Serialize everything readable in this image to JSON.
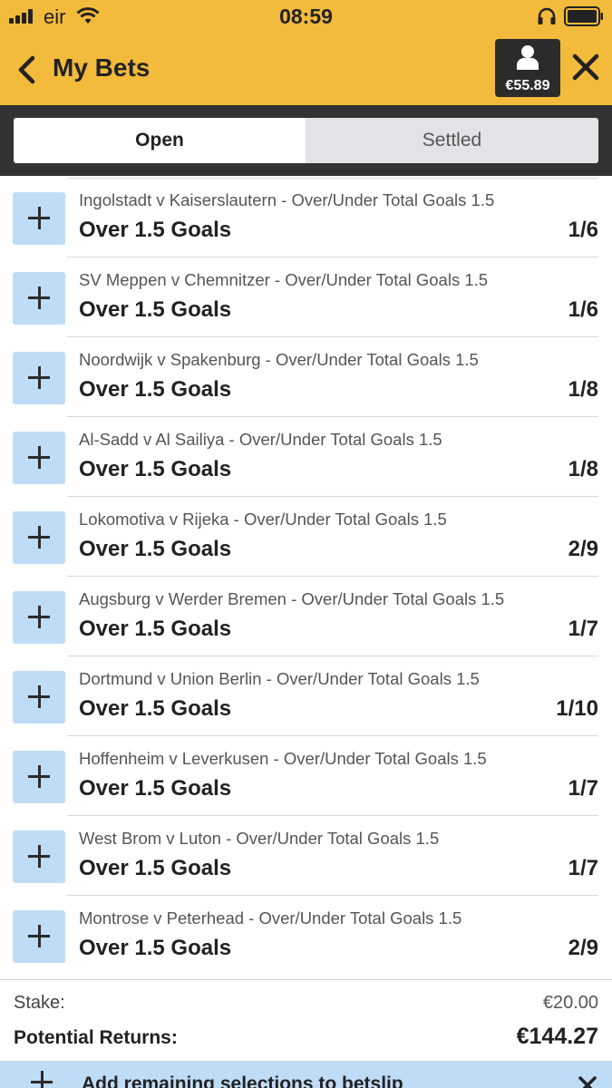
{
  "status_bar": {
    "carrier": "eir",
    "time": "08:59"
  },
  "header": {
    "title": "My Bets",
    "balance": "€55.89"
  },
  "tabs": [
    {
      "label": "Open",
      "active": true
    },
    {
      "label": "Settled",
      "active": false
    }
  ],
  "bets": [
    {
      "event": "Ingolstadt v Kaiserslautern - Over/Under Total Goals 1.5",
      "selection": "Over 1.5 Goals",
      "odds": "1/6"
    },
    {
      "event": "SV Meppen v Chemnitzer - Over/Under Total Goals 1.5",
      "selection": "Over 1.5 Goals",
      "odds": "1/6"
    },
    {
      "event": "Noordwijk v Spakenburg - Over/Under Total Goals 1.5",
      "selection": "Over 1.5 Goals",
      "odds": "1/8"
    },
    {
      "event": "Al-Sadd v Al Sailiya - Over/Under Total Goals 1.5",
      "selection": "Over 1.5 Goals",
      "odds": "1/8"
    },
    {
      "event": "Lokomotiva v Rijeka - Over/Under Total Goals 1.5",
      "selection": "Over 1.5 Goals",
      "odds": "2/9"
    },
    {
      "event": "Augsburg v Werder Bremen - Over/Under Total Goals 1.5",
      "selection": "Over 1.5 Goals",
      "odds": "1/7"
    },
    {
      "event": "Dortmund v Union Berlin - Over/Under Total Goals 1.5",
      "selection": "Over 1.5 Goals",
      "odds": "1/10"
    },
    {
      "event": "Hoffenheim v Leverkusen - Over/Under Total Goals 1.5",
      "selection": "Over 1.5 Goals",
      "odds": "1/7"
    },
    {
      "event": "West Brom v Luton - Over/Under Total Goals 1.5",
      "selection": "Over 1.5 Goals",
      "odds": "1/7"
    },
    {
      "event": "Montrose v Peterhead - Over/Under Total Goals 1.5",
      "selection": "Over 1.5 Goals",
      "odds": "2/9"
    }
  ],
  "summary": {
    "stake_label": "Stake:",
    "stake_value": "€20.00",
    "returns_label": "Potential Returns:",
    "returns_value": "€144.27"
  },
  "banner": {
    "text": "Add remaining selections to betslip"
  },
  "colors": {
    "header_yellow": "#f3bb3b",
    "tab_bar_dark": "#333333",
    "add_button_blue": "#bfdcf7"
  }
}
